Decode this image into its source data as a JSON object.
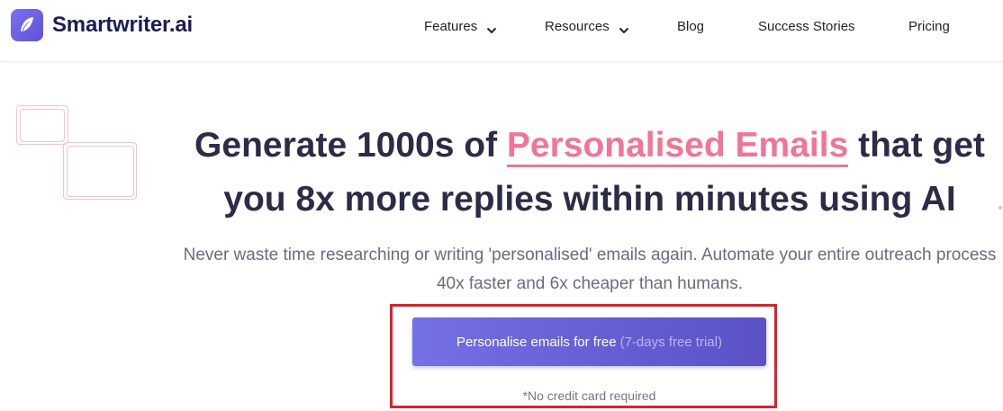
{
  "brand": {
    "name": "Smartwriter.ai",
    "logo_icon": "feather-icon",
    "accent_color": "#6b63e0"
  },
  "nav": {
    "items": [
      {
        "label": "Features",
        "has_dropdown": true
      },
      {
        "label": "Resources",
        "has_dropdown": true
      },
      {
        "label": "Blog",
        "has_dropdown": false
      },
      {
        "label": "Success Stories",
        "has_dropdown": false
      },
      {
        "label": "Pricing",
        "has_dropdown": false
      }
    ]
  },
  "hero": {
    "headline_prefix": "Generate 1000s of ",
    "headline_highlight": "Personalised Emails",
    "headline_suffix": " that get",
    "headline_line2": "you 8x more replies within minutes using AI",
    "highlight_color": "#f07596",
    "subtitle_line1": "Never waste time researching or writing 'personalised' emails again. Automate your entire outreach process",
    "subtitle_line2": "40x faster and 6x cheaper than humans.",
    "cta_label": "Personalise emails for free",
    "cta_trial": "(7-days free trial)",
    "cta_note": "*No credit card required",
    "highlight_box_color": "#e01f2b"
  }
}
